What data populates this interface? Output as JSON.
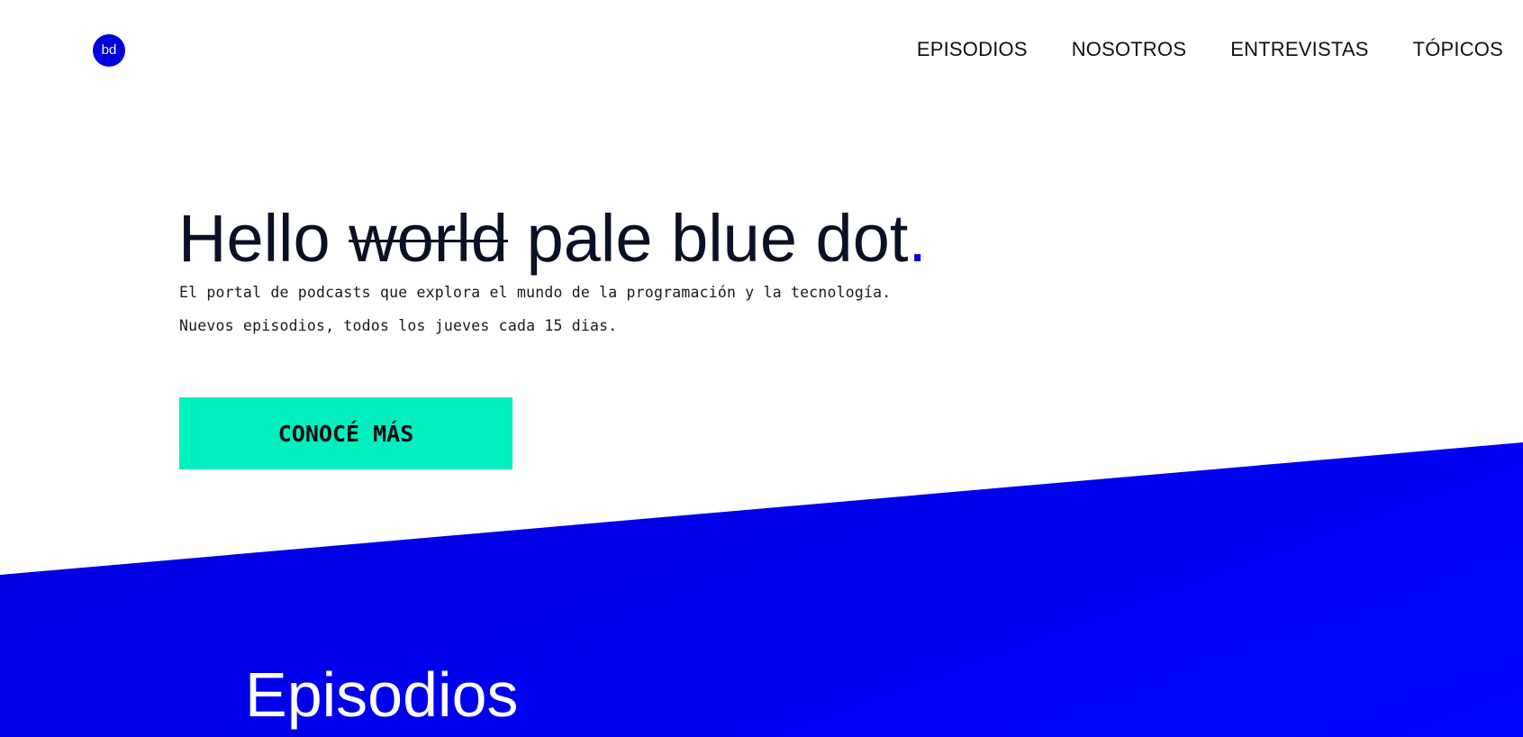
{
  "header": {
    "logo_text": "bd",
    "nav": [
      {
        "label": "EPISODIOS"
      },
      {
        "label": "NOSOTROS"
      },
      {
        "label": "ENTREVISTAS"
      },
      {
        "label": "TÓPICOS"
      }
    ]
  },
  "hero": {
    "title_prefix": "Hello",
    "title_struck": "world",
    "title_main": "pale blue dot",
    "title_dot": ".",
    "subtitle_line1": "El portal de podcasts que explora el mundo de la programación y la tecnología.",
    "subtitle_line2": "Nuevos episodios, todos los jueves cada 15 dias.",
    "cta_label": "CONOCÉ MÁS"
  },
  "episodes_section": {
    "title": "Episodios"
  },
  "colors": {
    "brand_blue": "#0000e6",
    "accent_mint": "#00f0c0",
    "text_dark": "#0b1026"
  }
}
